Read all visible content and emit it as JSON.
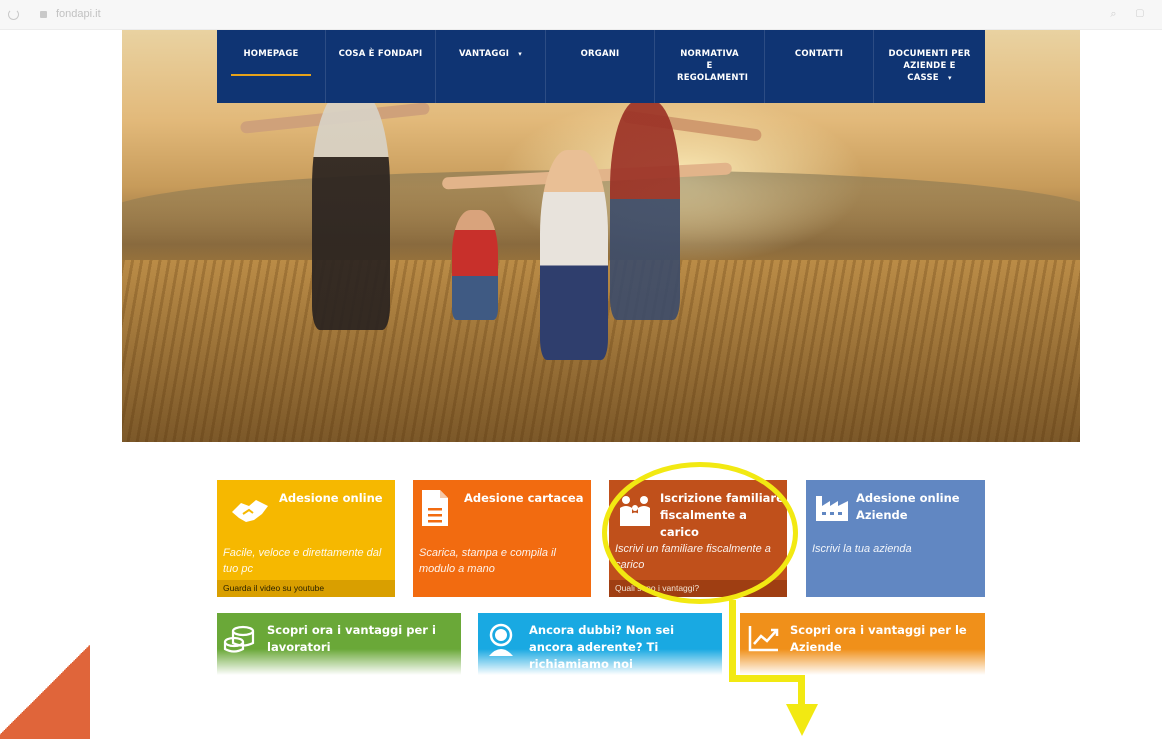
{
  "browser": {
    "url": "fondapi.it"
  },
  "nav": {
    "items": [
      {
        "label": "HOMEPAGE",
        "active": true,
        "has_dropdown": false
      },
      {
        "label": "COSA È FONDAPI",
        "active": false,
        "has_dropdown": false
      },
      {
        "label": "VANTAGGI",
        "active": false,
        "has_dropdown": true
      },
      {
        "label": "ORGANI",
        "active": false,
        "has_dropdown": false
      },
      {
        "label": "NORMATIVA E REGOLAMENTI",
        "active": false,
        "has_dropdown": false
      },
      {
        "label": "CONTATTI",
        "active": false,
        "has_dropdown": false
      },
      {
        "label": "DOCUMENTI PER AZIENDE E CASSE",
        "active": false,
        "has_dropdown": true
      }
    ],
    "caret": "▾"
  },
  "tiles": {
    "adesione_online": {
      "title": "Adesione online",
      "desc": "Facile, veloce e direttamente dal tuo pc",
      "footer": "Guarda il video su youtube",
      "icon": "handshake-icon"
    },
    "adesione_cartacea": {
      "title": "Adesione cartacea",
      "desc": "Scarica, stampa e compila il modulo a mano",
      "icon": "document-icon"
    },
    "iscrizione_familiare": {
      "title": "Iscrizione familiare fiscalmente a carico",
      "desc": "Iscrivi un familiare fiscalmente a carico",
      "footer": "Quali sono i vantaggi?",
      "icon": "family-icon"
    },
    "adesione_aziende": {
      "title": "Adesione online Aziende",
      "desc": "Iscrivi la tua azienda",
      "icon": "factory-icon"
    },
    "vantaggi_lavoratori": {
      "title": "Scopri ora i vantaggi per i lavoratori",
      "icon": "coins-icon"
    },
    "ancora_dubbi": {
      "title": "Ancora dubbi? Non sei ancora aderente? Ti richiamiamo noi",
      "icon": "support-agent-icon"
    },
    "vantaggi_aziende": {
      "title": "Scopri ora i vantaggi per le Aziende",
      "icon": "trend-chart-icon"
    }
  },
  "colors": {
    "nav_bg": "#0f3473",
    "nav_active_underline": "#e6a21a",
    "tile_yellow": "#f6b800",
    "tile_orange": "#f26b10",
    "tile_rust": "#c0501b",
    "tile_blue": "#6187c2",
    "tile_green": "#6aa838",
    "tile_cyan": "#19a9e2",
    "tile_amber": "#f0901a",
    "highlight": "#f2e912",
    "corner_accent": "#e0653a"
  }
}
